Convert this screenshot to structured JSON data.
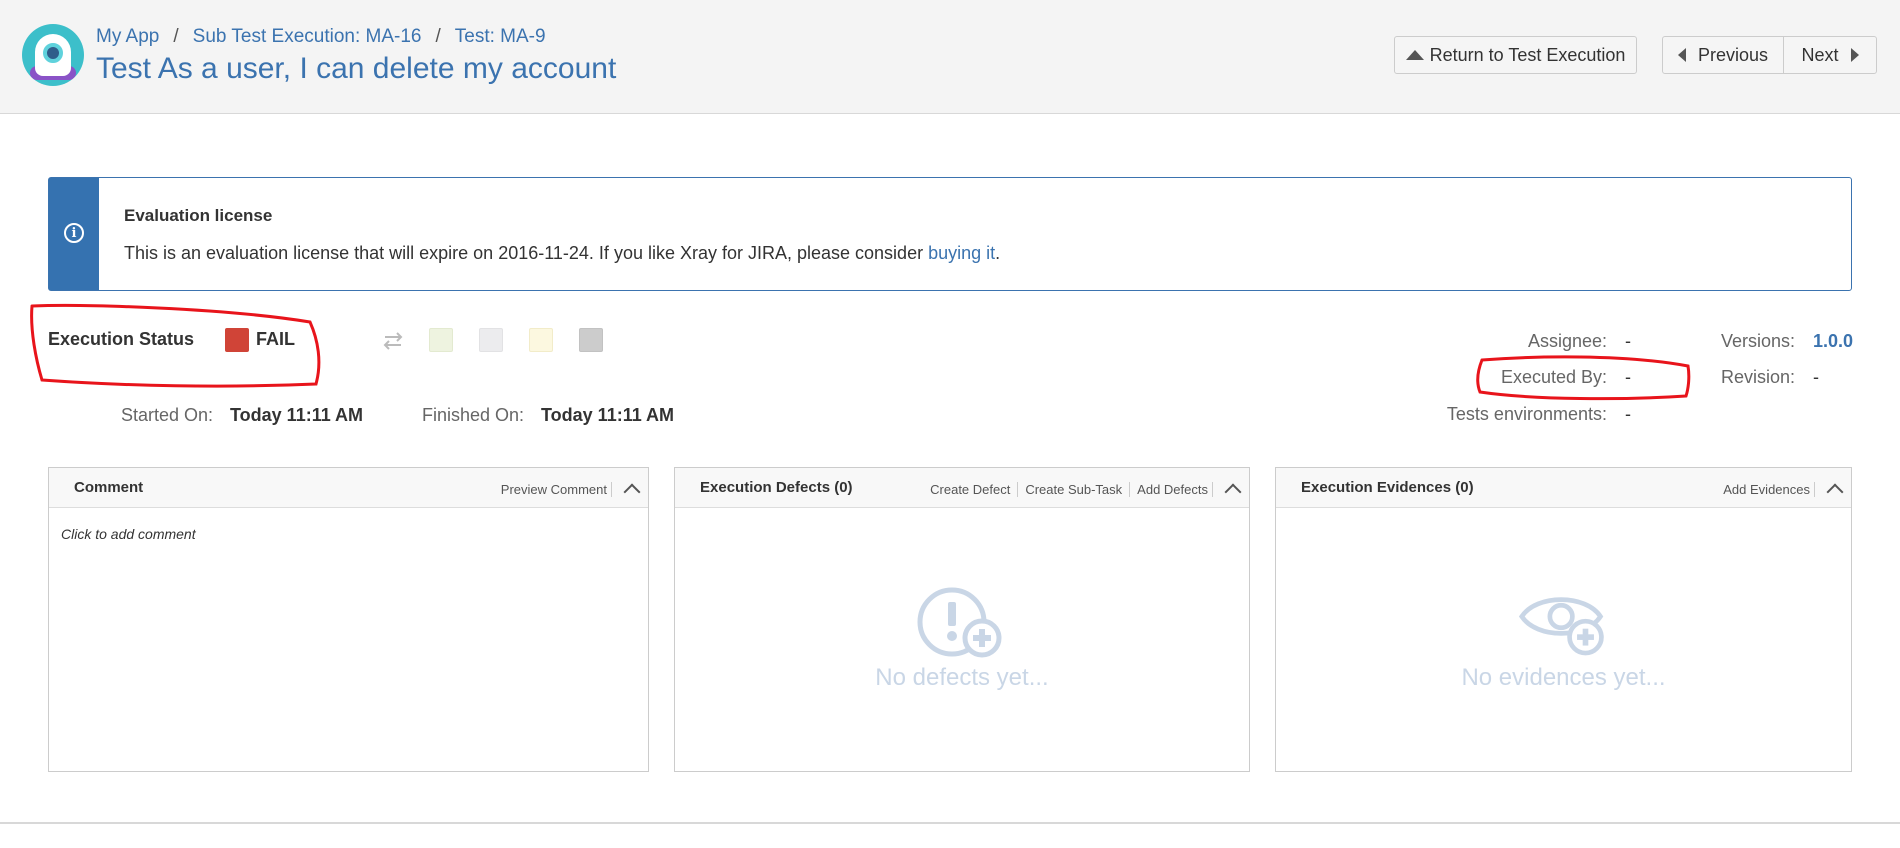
{
  "breadcrumb": {
    "app": "My App",
    "sub_test_execution": "Sub Test Execution: MA-16",
    "test": "Test: MA-9",
    "separator": "/"
  },
  "page_title": "Test As a user, I can delete my account",
  "buttons": {
    "return": "Return to Test Execution",
    "previous": "Previous",
    "next": "Next"
  },
  "license": {
    "title": "Evaluation license",
    "body_before": "This is an evaluation license that will expire on 2016-11-24. If you like Xray for JIRA, please consider ",
    "link": "buying it",
    "body_after": "."
  },
  "execution": {
    "status_label": "Execution Status",
    "status_value": "FAIL",
    "status_color": "#d04437",
    "status_options_colors": [
      "#eef3e0",
      "#ececec",
      "#fcf8e0",
      "#cccccc"
    ]
  },
  "timing": {
    "started_label": "Started On:",
    "started_value": "Today 11:11 AM",
    "finished_label": "Finished On:",
    "finished_value": "Today 11:11 AM"
  },
  "details": {
    "assignee_label": "Assignee:",
    "assignee_value": "-",
    "executed_by_label": "Executed By:",
    "executed_by_value": "-",
    "environments_label": "Tests environments:",
    "environments_value": "-",
    "versions_label": "Versions:",
    "versions_value": "1.0.0",
    "revision_label": "Revision:",
    "revision_value": "-"
  },
  "panels": {
    "comment": {
      "title": "Comment",
      "action_preview": "Preview Comment",
      "placeholder": "Click to add comment"
    },
    "defects": {
      "title": "Execution Defects (0)",
      "action_create_defect": "Create Defect",
      "action_create_subtask": "Create Sub-Task",
      "action_add_defects": "Add Defects",
      "empty": "No defects yet..."
    },
    "evidences": {
      "title": "Execution Evidences (0)",
      "action_add_evidences": "Add Evidences",
      "empty": "No evidences yet..."
    }
  },
  "colors": {
    "link": "#3b73af",
    "annotation": "#e8141b"
  }
}
